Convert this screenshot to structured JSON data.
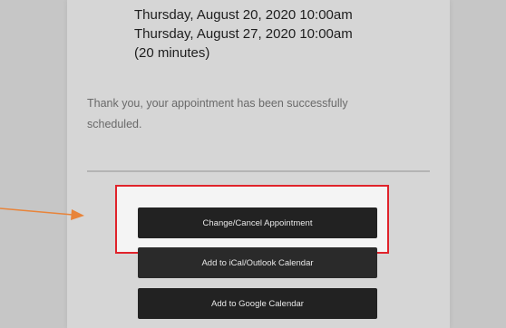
{
  "appointment": {
    "times": [
      "Thursday, August 20, 2020 10:00am",
      "Thursday, August 27, 2020 10:00am"
    ],
    "duration": "(20 minutes)",
    "confirmation_message": "Thank you, your appointment has been successfully scheduled."
  },
  "actions": {
    "change_cancel_label": "Change/Cancel Appointment",
    "ical_label": "Add to iCal/Outlook Calendar",
    "google_label": "Add to Google Calendar"
  },
  "annotation": {
    "highlight_color": "#e0232b",
    "arrow_color": "#e8843a"
  }
}
